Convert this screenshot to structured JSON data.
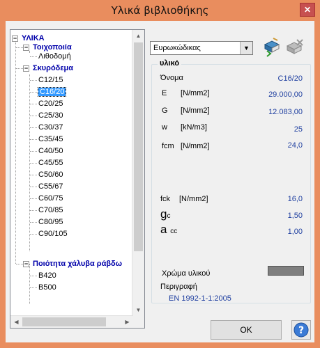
{
  "window": {
    "title": "Υλικά βιβλιοθήκης",
    "close_label": "✕"
  },
  "tree": {
    "root": "ΥΛΙΚΑ",
    "groups": [
      {
        "label": "Τοιχοποιία",
        "children": [
          "Λιθοδομή"
        ]
      },
      {
        "label": "Σκυρόδεμα",
        "children": [
          "C12/15",
          "C16/20",
          "C20/25",
          "C25/30",
          "C30/37",
          "C35/45",
          "C40/50",
          "C45/55",
          "C50/60",
          "C55/67",
          "C60/75",
          "C70/85",
          "C80/95",
          "C90/105"
        ]
      },
      {
        "label": "Ποιότητα χάλυβα ράβδω",
        "children": [
          "B420",
          "B500"
        ]
      }
    ],
    "selected": "C16/20"
  },
  "toolbar": {
    "standard": "Ευρωκώδικας"
  },
  "material": {
    "group_title": "υλικό",
    "name_label": "Όνομα",
    "name_value": "C16/20",
    "E_label": "E",
    "E_unit": "[N/mm2]",
    "E_value": "29.000,00",
    "G_label": "G",
    "G_unit": "[N/mm2]",
    "G_value": "12.083,00",
    "w_label": "w",
    "w_unit": "[kN/m3]",
    "w_value": "25",
    "fcm_label": "fcm",
    "fcm_unit": "[N/mm2]",
    "fcm_value": "24,0",
    "fck_label": "fck",
    "fck_unit": "[N/mm2]",
    "fck_value": "16,0",
    "gc_main": "g",
    "gc_sub": "c",
    "gc_value": "1,50",
    "acc_main": "a",
    "acc_sub": "cc",
    "acc_value": "1,00",
    "color_label": "Χρώμα υλικού",
    "color": "#7f7f7f",
    "desc_label": "Περιγραφή",
    "desc_value": "EN 1992-1-1:2005"
  },
  "buttons": {
    "ok": "OK",
    "help": "?"
  }
}
